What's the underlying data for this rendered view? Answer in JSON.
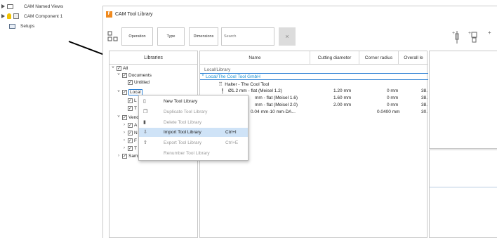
{
  "browser": {
    "items": [
      {
        "label": "CAM Named Views"
      },
      {
        "label": "CAM Component 1"
      },
      {
        "label": "Setups"
      }
    ]
  },
  "window": {
    "title": "CAM Tool Library",
    "app_icon_letter": "F",
    "toolbar": {
      "operation": "Operation",
      "type": "Type",
      "dimensions": "Dimensions",
      "search_placeholder": "Search",
      "clear": "×"
    }
  },
  "libraries": {
    "header": "Libraries",
    "tree": [
      {
        "label": "All",
        "chevron": "˅",
        "checked": "✓"
      },
      {
        "label": "Documents",
        "chevron": "˅",
        "checked": "✓"
      },
      {
        "label": "Untitled",
        "chevron": "",
        "checked": "✓"
      },
      {
        "label": "Local",
        "chevron": "˅",
        "checked": "✓"
      },
      {
        "label": "L",
        "chevron": "",
        "checked": "✓"
      },
      {
        "label": "T",
        "chevron": "",
        "checked": "✓"
      },
      {
        "label": "Vend",
        "chevron": "˅",
        "checked": "✓"
      },
      {
        "label": "A",
        "chevron": "›",
        "checked": "✓"
      },
      {
        "label": "N",
        "chevron": "›",
        "checked": "✓"
      },
      {
        "label": "F",
        "chevron": "›",
        "checked": "✓"
      },
      {
        "label": "T",
        "chevron": "›",
        "checked": "✓"
      },
      {
        "label": "Samples",
        "chevron": "›",
        "checked": "✓"
      }
    ]
  },
  "tools": {
    "columns": [
      "Name",
      "Cutting diameter",
      "Corner radius",
      "Overall le"
    ],
    "groups": [
      {
        "label": "Local/Library"
      },
      {
        "label": "Local/The Cool Tool GmbH"
      }
    ],
    "holder": "Halter - The Cool Tool",
    "rows": [
      {
        "name": "Ø1.2 mm - flat (Meisel 1.2)",
        "diameter": "1.20 mm",
        "radius": "0 mm",
        "length": "38."
      },
      {
        "name": "mm - flat (Meisel 1.6)",
        "diameter": "1.60 mm",
        "radius": "0 mm",
        "length": "38."
      },
      {
        "name": "mm - flat (Meisel 2.0)",
        "diameter": "2.00 mm",
        "radius": "0 mm",
        "length": "38."
      },
      {
        "name": "0.04 mm-10 mm-DA...",
        "diameter": "",
        "radius": "0.0400 mm",
        "length": "30."
      }
    ]
  },
  "context_menu": {
    "items": [
      {
        "label": "New Tool Library",
        "shortcut": "",
        "icon": "new-library-icon",
        "disabled": false
      },
      {
        "label": "Duplicate Tool Library",
        "shortcut": "",
        "icon": "duplicate-icon",
        "disabled": true
      },
      {
        "label": "Delete Tool Library",
        "shortcut": "",
        "icon": "trash-icon",
        "disabled": true
      },
      {
        "label": "Import Tool Library",
        "shortcut": "Ctrl+I",
        "icon": "import-icon",
        "disabled": false
      },
      {
        "label": "Export Tool Library",
        "shortcut": "Ctrl+E",
        "icon": "export-icon",
        "disabled": true
      },
      {
        "label": "Renumber Tool Library",
        "shortcut": "",
        "icon": "",
        "disabled": true
      }
    ]
  },
  "colors": {
    "accent": "#2a7fd4",
    "highlight": "#cfe3f7",
    "group_text": "#1a8fd0"
  }
}
